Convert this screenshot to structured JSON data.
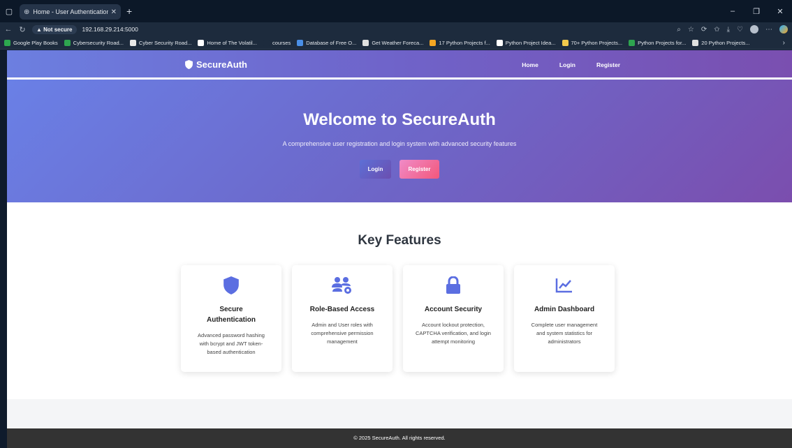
{
  "browser": {
    "tab_title": "Home - User Authentication Syst",
    "security_label": "Not secure",
    "url": "192.168.29.214:5000",
    "bookmarks": [
      {
        "label": "Google Play Books",
        "color": "#2da94f"
      },
      {
        "label": "Cybersecurity Road...",
        "color": "#2ea44f"
      },
      {
        "label": "Cyber Security Road...",
        "color": "#e8e8e8"
      },
      {
        "label": "Home of The Volatil...",
        "color": "#ffffff"
      },
      {
        "label": "courses",
        "color": "#1d2b3d"
      },
      {
        "label": "Database of Free O...",
        "color": "#4a8fe7"
      },
      {
        "label": "Get Weather Foreca...",
        "color": "#e0e0e0"
      },
      {
        "label": "17 Python Projects f...",
        "color": "#f5a623"
      },
      {
        "label": "Python Project Idea...",
        "color": "#ffffff"
      },
      {
        "label": "70+ Python Projects...",
        "color": "#f2c94c"
      },
      {
        "label": "Python Projects for...",
        "color": "#2ea44f"
      },
      {
        "label": "20 Python Projects...",
        "color": "#e0e0e0"
      }
    ]
  },
  "navbar": {
    "brand": "SecureAuth",
    "links": [
      "Home",
      "Login",
      "Register"
    ]
  },
  "hero": {
    "title": "Welcome to SecureAuth",
    "subtitle": "A comprehensive user registration and login system with advanced security features",
    "login_label": "Login",
    "register_label": "Register"
  },
  "features": {
    "heading": "Key Features",
    "accent_color": "#5b6ee1",
    "cards": [
      {
        "icon": "shield-icon",
        "title": "Secure Authentication",
        "text": "Advanced password hashing with bcrypt and JWT token-based authentication"
      },
      {
        "icon": "users-cog-icon",
        "title": "Role-Based Access",
        "text": "Admin and User roles with comprehensive permission management"
      },
      {
        "icon": "lock-icon",
        "title": "Account Security",
        "text": "Account lockout protection, CAPTCHA verification, and login attempt monitoring"
      },
      {
        "icon": "chart-line-icon",
        "title": "Admin Dashboard",
        "text": "Complete user management and system statistics for administrators"
      }
    ]
  },
  "footer": {
    "text": "© 2025 SecureAuth. All rights reserved."
  }
}
